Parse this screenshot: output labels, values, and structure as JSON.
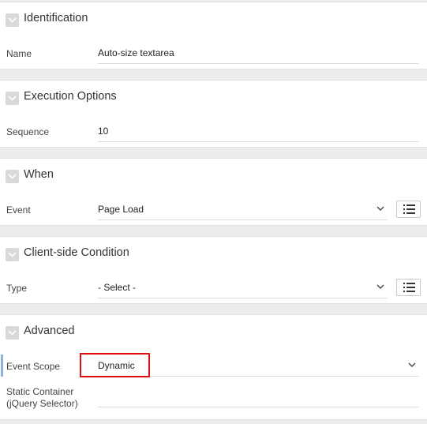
{
  "sections": {
    "identification": {
      "title": "Identification",
      "fields": {
        "name": {
          "label": "Name",
          "value": "Auto-size textarea"
        }
      }
    },
    "execution": {
      "title": "Execution Options",
      "fields": {
        "sequence": {
          "label": "Sequence",
          "value": "10"
        }
      }
    },
    "when": {
      "title": "When",
      "fields": {
        "event": {
          "label": "Event",
          "value": "Page Load"
        }
      }
    },
    "client_condition": {
      "title": "Client-side Condition",
      "fields": {
        "type": {
          "label": "Type",
          "value": "- Select -"
        }
      }
    },
    "advanced": {
      "title": "Advanced",
      "fields": {
        "event_scope": {
          "label": "Event Scope",
          "value": "Dynamic"
        },
        "static_container": {
          "label_line1": "Static Container",
          "label_line2": "(jQuery Selector)",
          "value": ""
        }
      }
    }
  },
  "icons": {
    "section_toggle": "chevron-down-icon",
    "dropdown": "chevron-down-icon",
    "list_of_values": "list-icon"
  },
  "colors": {
    "highlight": "#e01010",
    "focus_bar": "#8fb3db",
    "background": "#ececec"
  }
}
